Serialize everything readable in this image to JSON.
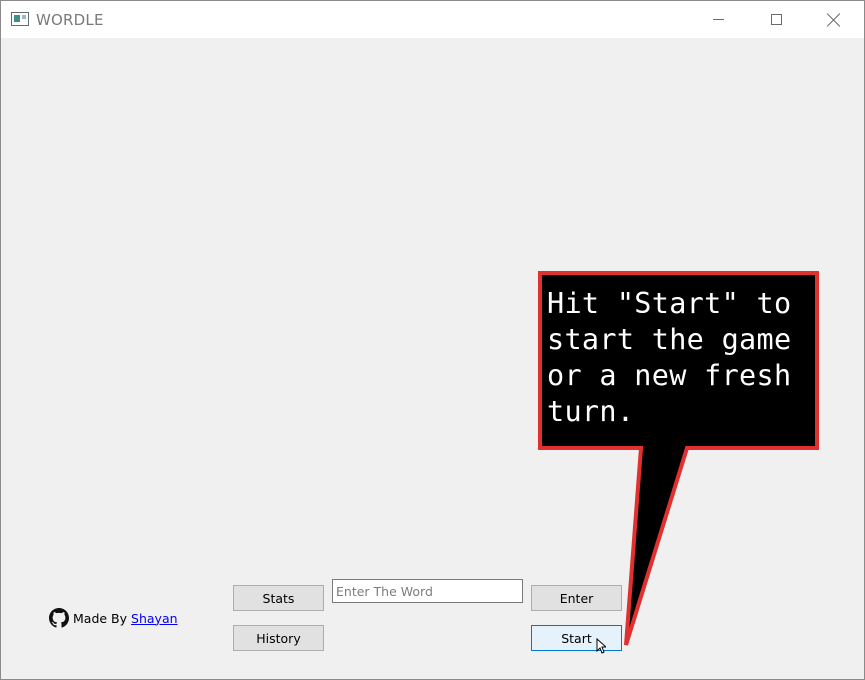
{
  "window": {
    "title": "WORDLE",
    "controls": [
      "minimize",
      "maximize",
      "close"
    ]
  },
  "buttons": {
    "stats": "Stats",
    "history": "History",
    "enter": "Enter",
    "start": "Start"
  },
  "input": {
    "value": "",
    "placeholder": "Enter The Word"
  },
  "credit": {
    "prefix": "Made By",
    "author": "Shayan",
    "icon": "github-icon"
  },
  "callout": {
    "text": "Hit \"Start\" to\nstart the game\nor a new fresh\nturn.",
    "fill": "#000000",
    "border": "#e03030"
  },
  "colors": {
    "window_bg": "#f0f0f0",
    "active_button": "#e5f1fb",
    "active_border": "#0078d7"
  }
}
